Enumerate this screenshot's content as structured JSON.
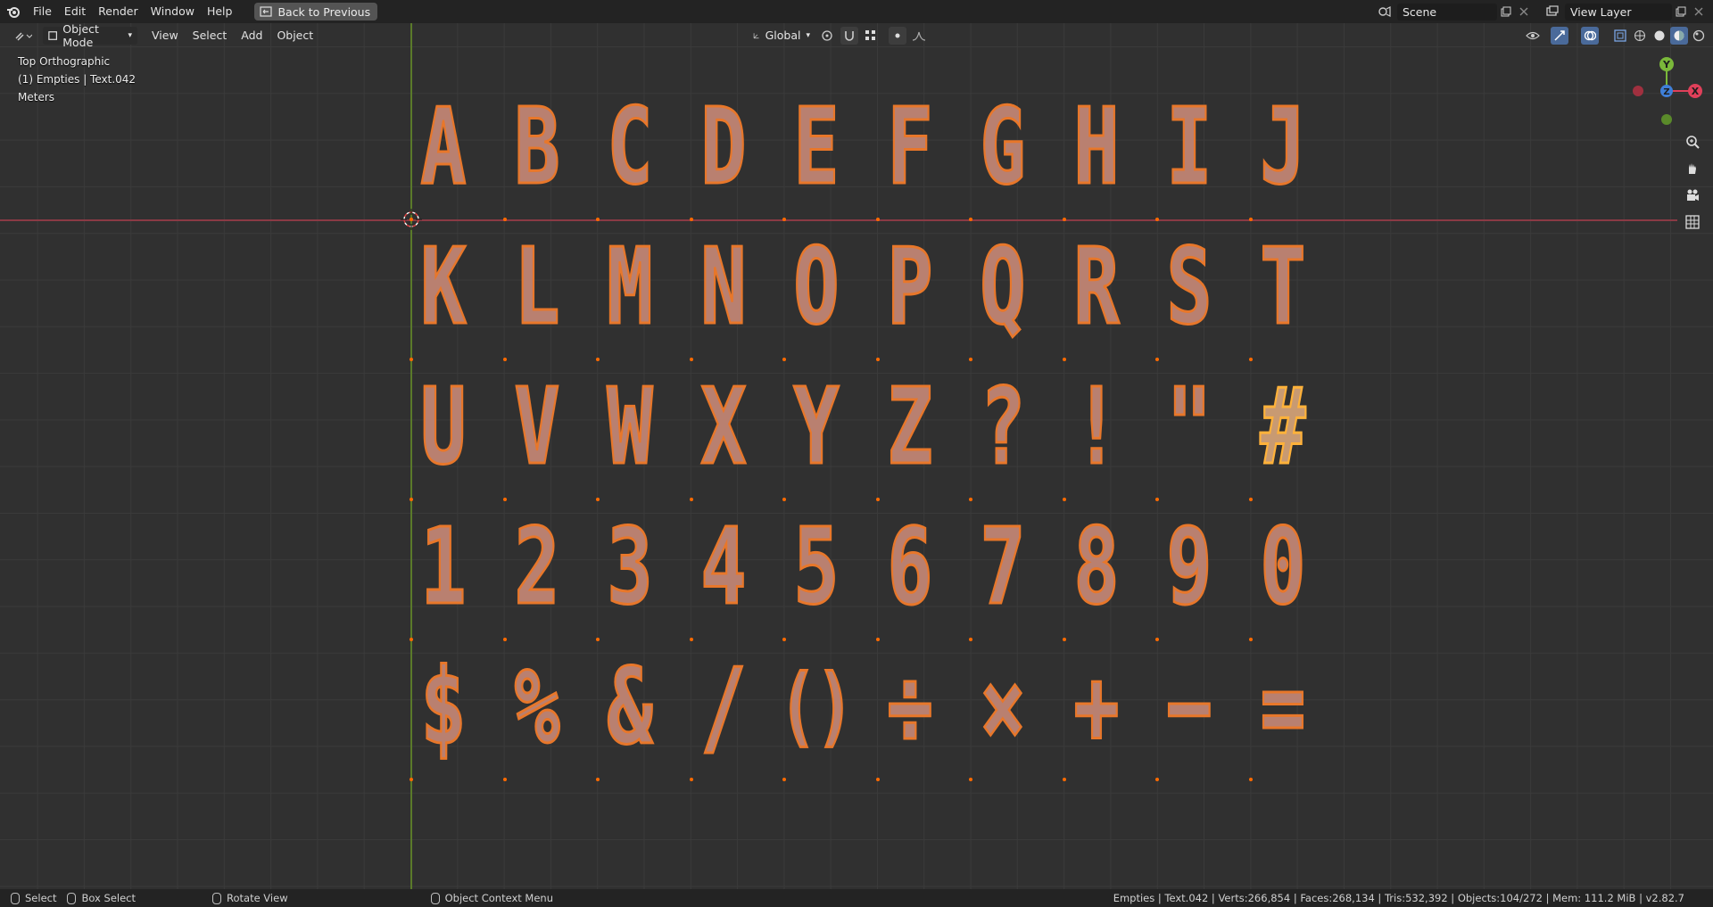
{
  "topbar": {
    "menus": [
      "File",
      "Edit",
      "Render",
      "Window",
      "Help"
    ],
    "back_button": "Back to Previous",
    "scene_label": "Scene",
    "view_layer_label": "View Layer"
  },
  "viewport_header": {
    "mode": "Object Mode",
    "menus": [
      "View",
      "Select",
      "Add",
      "Object"
    ],
    "transform_orientation": "Global"
  },
  "overlay": {
    "view_name": "Top Orthographic",
    "selection": "(1) Empties | Text.042",
    "units": "Meters"
  },
  "gizmo": {
    "y": "Y",
    "z": "Z",
    "x": "X"
  },
  "glyph_rows": [
    [
      "A",
      "B",
      "C",
      "D",
      "E",
      "F",
      "G",
      "H",
      "I",
      "J"
    ],
    [
      "K",
      "L",
      "M",
      "N",
      "O",
      "P",
      "Q",
      "R",
      "S",
      "T"
    ],
    [
      "U",
      "V",
      "W",
      "X",
      "Y",
      "Z",
      "?",
      "!",
      "\"",
      "#"
    ],
    [
      "1",
      "2",
      "3",
      "4",
      "5",
      "6",
      "7",
      "8",
      "9",
      "0"
    ],
    [
      "$",
      "%",
      "&",
      "/",
      "()",
      "÷",
      "×",
      "+",
      "−",
      "="
    ]
  ],
  "statusbar": {
    "select": "Select",
    "box_select": "Box Select",
    "rotate_view": "Rotate View",
    "context_menu": "Object Context Menu",
    "stats": "Empties | Text.042 | Verts:266,854 | Faces:268,134 | Tris:532,392 | Objects:104/272 | Mem: 111.2 MiB | v2.82.7"
  },
  "colors": {
    "outline": "#e8772a",
    "active_outline": "#ffb23a",
    "x_axis": "#8a3a44",
    "y_axis": "#5a7a2a"
  }
}
